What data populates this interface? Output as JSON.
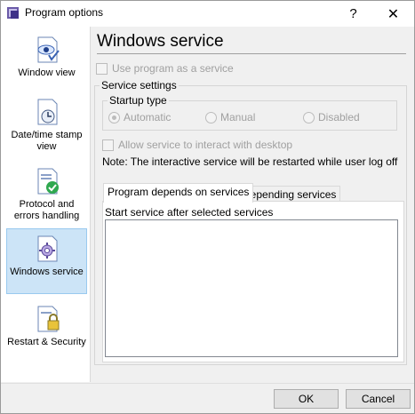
{
  "window": {
    "title": "Program options",
    "help_glyph": "?",
    "close_glyph": "✕"
  },
  "sidebar": {
    "items": [
      {
        "label": "Window view",
        "icon": "eye-document-icon"
      },
      {
        "label": "Date/time stamp view",
        "icon": "clock-document-icon"
      },
      {
        "label": "Protocol and errors handling",
        "icon": "checkmark-document-icon"
      },
      {
        "label": "Windows service",
        "icon": "gear-document-icon",
        "selected": true
      },
      {
        "label": "Restart & Security",
        "icon": "lock-document-icon"
      }
    ]
  },
  "main": {
    "title": "Windows service",
    "use_as_service_label": "Use program as a service",
    "service_settings": {
      "label": "Service settings",
      "startup_type": {
        "label": "Startup type",
        "options": [
          "Automatic",
          "Manual",
          "Disabled"
        ],
        "selected": "Automatic"
      },
      "interact_label": "Allow service to interact with desktop",
      "note": "Note: The interactive service will be restarted while user log off"
    },
    "tabs": [
      {
        "label": "Program depends on services",
        "active": true
      },
      {
        "label": "Depending services",
        "active": false
      }
    ],
    "panel_label": "Start service after selected services"
  },
  "footer": {
    "ok_label": "OK",
    "cancel_label": "Cancel"
  }
}
